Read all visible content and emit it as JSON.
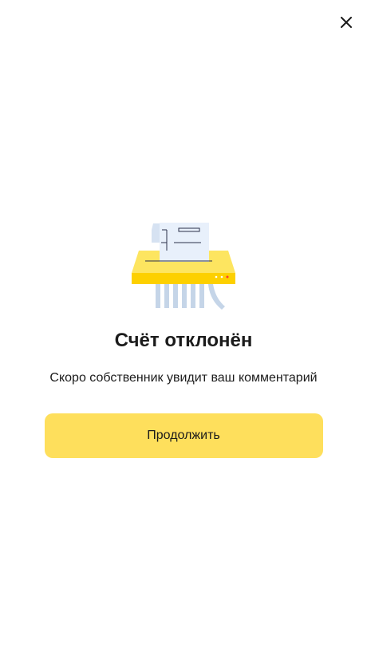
{
  "header": {
    "close_icon": "close-icon"
  },
  "illustration": {
    "icon": "document-shredder-icon",
    "colors": {
      "paper": "#e8f0fb",
      "shredder_top": "#fde560",
      "shredder_body": "#fdd000",
      "strips": "#c5d5e8",
      "lines": "#2a2f4a",
      "indicator_red": "#ff3b30"
    }
  },
  "main": {
    "title": "Счёт отклонён",
    "subtitle": "Скоро собственник увидит ваш комментарий",
    "continue_label": "Продолжить"
  },
  "colors": {
    "accent": "#fedf5c",
    "text": "#1b1b1b",
    "background": "#ffffff"
  }
}
